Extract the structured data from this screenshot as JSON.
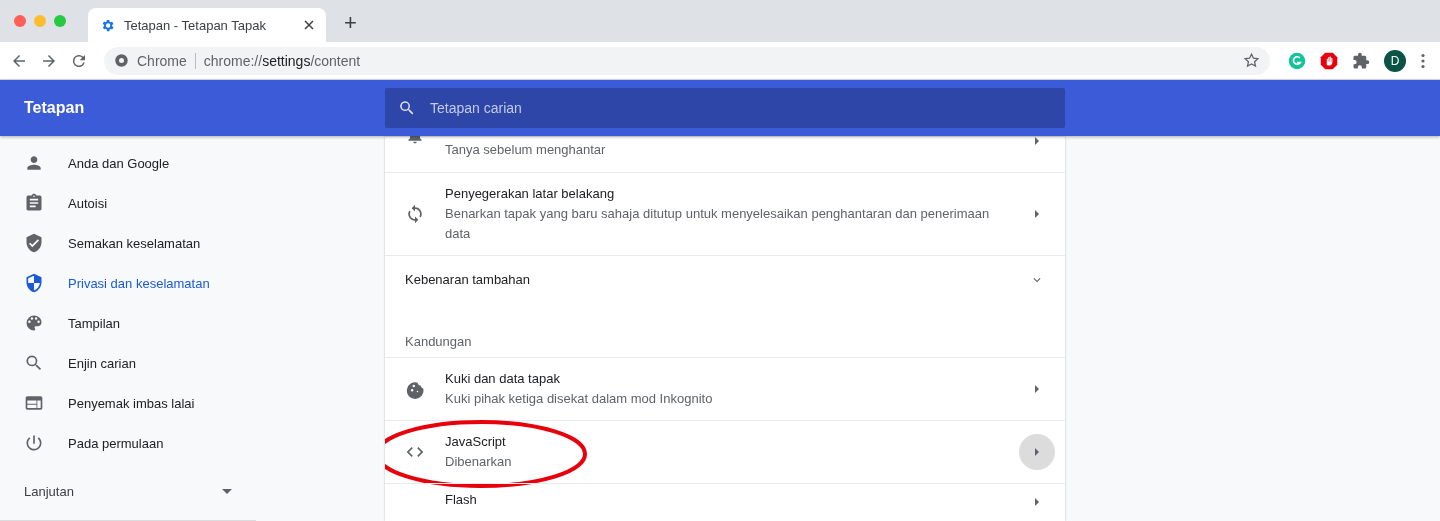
{
  "browser": {
    "tabs": [
      {
        "title": "Tetapan - Tetapan Tapak",
        "selected": true
      }
    ],
    "new_tab": "+",
    "address": {
      "label": "Chrome",
      "url": "chrome://**settings**/content"
    },
    "avatar": "D"
  },
  "header": {
    "title": "Tetapan",
    "search": {
      "placeholder": "Tetapan carian"
    }
  },
  "sidebar": {
    "items": [
      {
        "label": "Anda dan Google",
        "selected": false
      },
      {
        "label": "Autoisi",
        "selected": false
      },
      {
        "label": "Semakan keselamatan",
        "selected": false
      },
      {
        "label": "Privasi dan keselamatan",
        "selected": true
      },
      {
        "label": "Tampilan",
        "selected": false
      },
      {
        "label": "Enjin carian",
        "selected": false
      },
      {
        "label": "Penyemak imbas lalai",
        "selected": false
      },
      {
        "label": "Pada permulaan",
        "selected": false
      }
    ],
    "advanced": {
      "label": "Lanjutan",
      "expanded": false
    }
  },
  "content": {
    "rows": [
      {
        "kind": "link",
        "subtitle": "Tanya sebelum menghantar",
        "hovered": false
      },
      {
        "kind": "link",
        "title": "Penyegerakan latar belakang",
        "subtitle": "Benarkan tapak yang baru sahaja ditutup untuk menyelesaikan penghantaran dan penerimaan data",
        "hovered": false
      },
      {
        "kind": "expand",
        "title": "Kebenaran tambahan",
        "expanded": false
      },
      {
        "kind": "heading",
        "title": "Kandungan"
      },
      {
        "kind": "link",
        "title": "Kuki dan data tapak",
        "subtitle": "Kuki pihak ketiga disekat dalam mod Inkognito",
        "hovered": false
      },
      {
        "kind": "link",
        "title": "JavaScript",
        "subtitle": "Dibenarkan",
        "hovered": true,
        "circled": true
      },
      {
        "kind": "link",
        "title": "Flash",
        "hovered": false
      }
    ]
  }
}
